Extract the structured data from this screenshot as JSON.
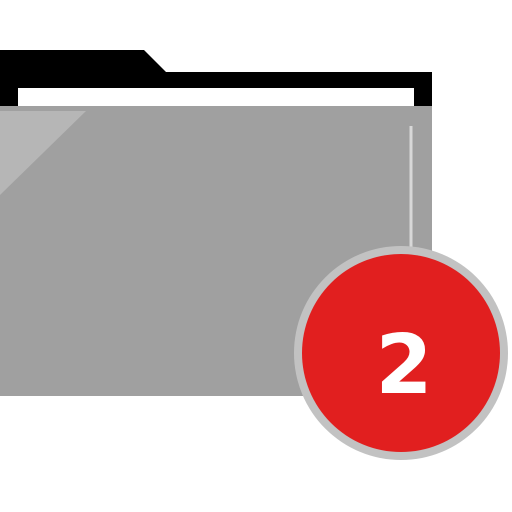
{
  "icon": {
    "name": "folder-icon",
    "tab_color": "#000000",
    "paper_color": "#ffffff",
    "body_color": "#a0a0a0",
    "highlight_color": "#b6b6b6"
  },
  "badge": {
    "name": "notification-badge",
    "count": "2",
    "fill_color": "#e11f1f",
    "ring_color": "#c2c2c2",
    "text_color": "#ffffff"
  }
}
